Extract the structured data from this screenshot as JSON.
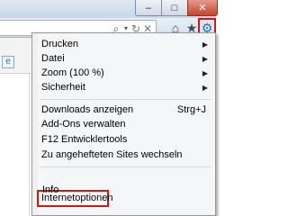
{
  "window": {
    "minimize_glyph": "–",
    "maximize_glyph": "□",
    "close_glyph": "✕"
  },
  "toolbar": {
    "search_glyph": "⌕",
    "dropdown_glyph": "▾",
    "refresh_glyph": "↻",
    "stop_glyph": "✕",
    "home_glyph": "⌂",
    "favorites_glyph": "★",
    "tools_glyph": "⚙",
    "tools_highlight_color": "#d9140e"
  },
  "tab": {
    "favicon_glyph": "e"
  },
  "menu": {
    "items": [
      {
        "label": "Drucken",
        "submenu": true
      },
      {
        "label": "Datei",
        "submenu": true
      },
      {
        "label": "Zoom (100 %)",
        "submenu": true
      },
      {
        "label": "Sicherheit",
        "submenu": true
      },
      {
        "label": "Downloads anzeigen",
        "shortcut": "Strg+J"
      },
      {
        "label": "Add-Ons verwalten"
      },
      {
        "label": "F12 Entwicklertools"
      },
      {
        "label": "Zu angehefteten Sites wechseln"
      },
      {
        "label": "Internetoptionen",
        "highlighted": true
      },
      {
        "label": "Info"
      }
    ],
    "submenu_arrow": "▶",
    "highlight_color": "#d9140e"
  }
}
